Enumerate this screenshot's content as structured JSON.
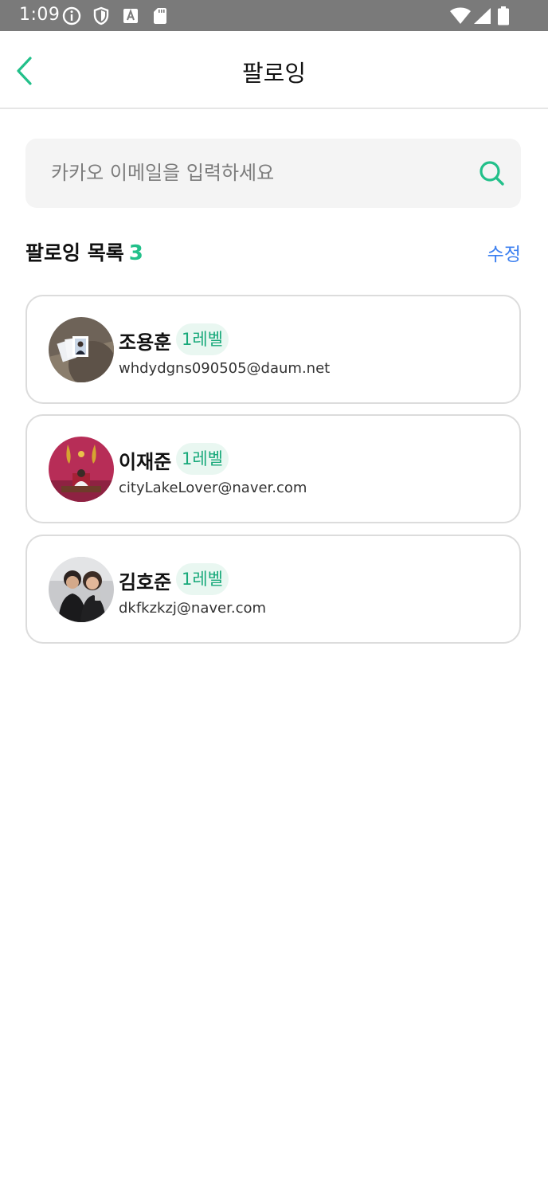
{
  "status_bar": {
    "time": "1:09",
    "icons": [
      "info-icon",
      "shield-icon",
      "a-badge-icon",
      "sd-card-icon",
      "wifi-icon",
      "signal-icon",
      "battery-icon"
    ]
  },
  "header": {
    "title": "팔로잉",
    "back_icon": "chevron-left-icon"
  },
  "search": {
    "placeholder": "카카오 이메일을 입력하세요",
    "value": "",
    "icon": "search-icon"
  },
  "following": {
    "title": "팔로잉 목록",
    "count": "3",
    "edit_label": "수정",
    "users": [
      {
        "name": "조용훈",
        "level": "1레벨",
        "email": "whdydgns090505@daum.net"
      },
      {
        "name": "이재준",
        "level": "1레벨",
        "email": "cityLakeLover@naver.com"
      },
      {
        "name": "김호준",
        "level": "1레벨",
        "email": "dkfkzkzj@naver.com"
      }
    ]
  },
  "colors": {
    "accent": "#22c08a",
    "link": "#3b7ff0",
    "status_bar": "#7a7a7a",
    "badge_bg": "#e9f7f1"
  }
}
